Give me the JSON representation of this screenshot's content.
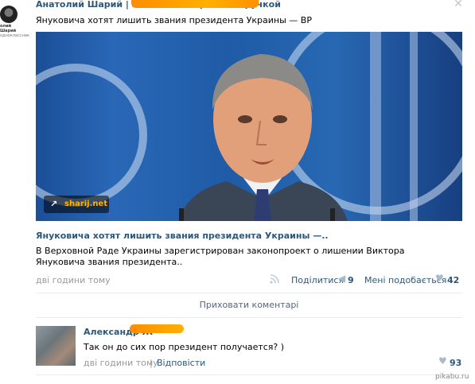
{
  "group": {
    "avatar_name": "олий Шарий",
    "avatar_sub": "одноклассник",
    "header_text": "Анатолий Шарий | Новости с шариковой ручкой"
  },
  "post": {
    "text": "Януковича хотят лишить звания президента Украины — ВР",
    "image_badge": "sharij.net",
    "link_title": "Януковича хотят лишить звания президента Украины —..",
    "link_description": "В Верховной Раде Украины зарегистрирован законопроект о лишении Виктора Януковича звания президента..",
    "time": "дві години тому",
    "share_label": "Поділитися",
    "share_count": "9",
    "like_label": "Мені подобається",
    "like_count": "42"
  },
  "hide_comments_label": "Приховати коментарі",
  "comment": {
    "author": "Александр Ж",
    "text": "Так он до сих пор президент получается? )",
    "time": "дві години тому",
    "separator": "|",
    "reply_label": "Відповісти",
    "like_count": "93"
  },
  "watermark": {
    "site": "pikabu.ru"
  },
  "icons": {
    "close": "close-icon",
    "rss": "rss-icon",
    "share": "megaphone-icon",
    "like": "heart-icon"
  },
  "colors": {
    "link": "#2b587a",
    "muted": "#999999",
    "icon": "#a9b9ca",
    "censor": "#ff9800"
  }
}
